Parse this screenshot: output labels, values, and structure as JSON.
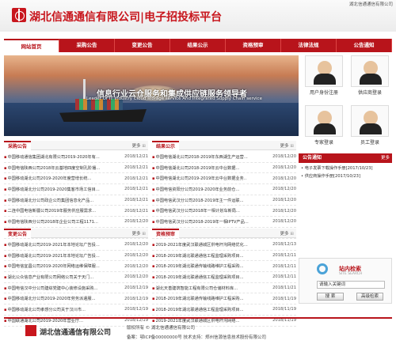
{
  "header": {
    "company_top": "湖北信通通信有限公司",
    "logo_text": "湖北信通通信有限公司|电子招投标平台"
  },
  "nav": [
    "网站首页",
    "采购公告",
    "变更公告",
    "结果公示",
    "资格预审",
    "法律法规",
    "公告通知"
  ],
  "banner": {
    "cn": "信息行业云仓服务和集成供应链服务领导者",
    "en": "Leader Of IT Industry Cloud storage service And Integrated Supply Chain service"
  },
  "side_icons": [
    "用户身份注册",
    "供应商登录",
    "专家登录",
    "员工登录"
  ],
  "more_label": "更多",
  "purchase": {
    "title": "采购公告",
    "rows": [
      {
        "t": "中国移动通信集团湖北有限公司2019-2020年有...",
        "d": "2018/12/21"
      },
      {
        "t": "中国电信陕西公司2018年云基地四度空制孔阶播...",
        "d": "2018/12/21"
      },
      {
        "t": "中国移动湖北公司2019-2020年度营增长统...",
        "d": "2018/12/21"
      },
      {
        "t": "中国移动湖北分公司2019-2020集客市场工信目...",
        "d": "2018/12/21"
      },
      {
        "t": "中国移动湖北分公司政企公司集团信息化产品...",
        "d": "2018/12/21"
      },
      {
        "t": "二连中国电信新疆公司2019年服务供应服需求...",
        "d": "2018/12/21"
      },
      {
        "t": "中国电信陕西分公司2018年企业公司工程1171...",
        "d": "2018/12/20"
      },
      {
        "t": "中国电信武汉分公司2019-2020年营业厅配套...",
        "d": "2018/12/20"
      }
    ]
  },
  "result": {
    "title": "结果公示",
    "rows": [
      {
        "t": "中国电信湖北公司2018-2019年东西湖生产运营...",
        "d": "2018/12/20"
      },
      {
        "t": "中国电信湖北公司2018-2019年云中台数据...",
        "d": "2018/12/20"
      },
      {
        "t": "中国电信湖北公司2019-2019年云中台数据业务..",
        "d": "2018/12/20"
      },
      {
        "t": "中国电信资阳分公司2019-2020年业务前仓...",
        "d": "2018/12/20"
      },
      {
        "t": "中国电信武汉分公司2018-2019年主一件运联...",
        "d": "2018/12/20"
      },
      {
        "t": "中国电信武汉分公司2018年一相计划车新局...",
        "d": "2018/12/20"
      },
      {
        "t": "中国电信武汉分公司2018-2019年一相IPTV产品...",
        "d": "2018/12/20"
      },
      {
        "t": "中国电信武汉分公司营商付款项目CN2互联系统...",
        "d": "2018/12/20"
      }
    ]
  },
  "change": {
    "title": "变更公告",
    "rows": [
      {
        "t": "中国移动湖北公司2019-2021年本地论坛广告投...",
        "d": "2018/12/20"
      },
      {
        "t": "中国移动湖北公司2019-2021年本地论坛广告投...",
        "d": "2018/12/20"
      },
      {
        "t": "中国电信宜昌公司2019-2020年网络运维保障服...",
        "d": "2018/12/20"
      },
      {
        "t": "湖北公众信息产业有限公司网络公司关于天门...",
        "d": "2018/12/20"
      },
      {
        "t": "中国电信汉中分公司建综党建中心装修设施采购...",
        "d": "2018/12/19"
      },
      {
        "t": "中国移动湖北分公司2019-2020年劳务派遣服...",
        "d": "2018/12/19"
      },
      {
        "t": "中国移动湖北公司孝感分公司关于汉川市...",
        "d": "2018/12/19"
      },
      {
        "t": "中国联通湖北公司2019-2020年营业厅...",
        "d": "2018/12/19"
      }
    ]
  },
  "prequal": {
    "title": "资格预审",
    "rows": [
      {
        "t": "2019-2021年度武汉联通城区供电杆沟网络优化...",
        "d": "2018/12/13"
      },
      {
        "t": "2018-2019年湖北联通通信工程监理采购项目...",
        "d": "2018/12/11"
      },
      {
        "t": "2018-2019年湖北联通传输线路维护工程采购...",
        "d": "2018/12/11"
      },
      {
        "t": "2018-2019年湖北联通通信工程监理采购项目...",
        "d": "2018/12/11"
      },
      {
        "t": "湖北天善建筑智能工程有限公司仓储材料库...",
        "d": "2018/11/21"
      },
      {
        "t": "2018-2019年湖北联通传输线路维护工程采购...",
        "d": "2018/11/19"
      },
      {
        "t": "2018-2019年湖北联通通信工程监理采购项目...",
        "d": "2018/11/19"
      },
      {
        "t": "2019-2021年度武汉联通城区供电杆沟网络...",
        "d": "2018/11/19"
      }
    ]
  },
  "notice": {
    "title": "公告通知",
    "items": [
      "电子发票下载操作手册[2017/10/23]",
      "供应商操作手册[2017/10/23]"
    ]
  },
  "search": {
    "title": "站内检索",
    "subtitle": "SITE SEARCH",
    "placeholder": "请输入关键词",
    "search_btn": "搜 索",
    "advanced_btn": "高级检索"
  },
  "footer": {
    "logo_text": "湖北信通通信有限公司",
    "line1": "版权所有 © 湖北信通通信有限公司",
    "line2": "备案：鄂ICP备00000000号  技术支持：郑州信源信息技术股份有限公司"
  }
}
